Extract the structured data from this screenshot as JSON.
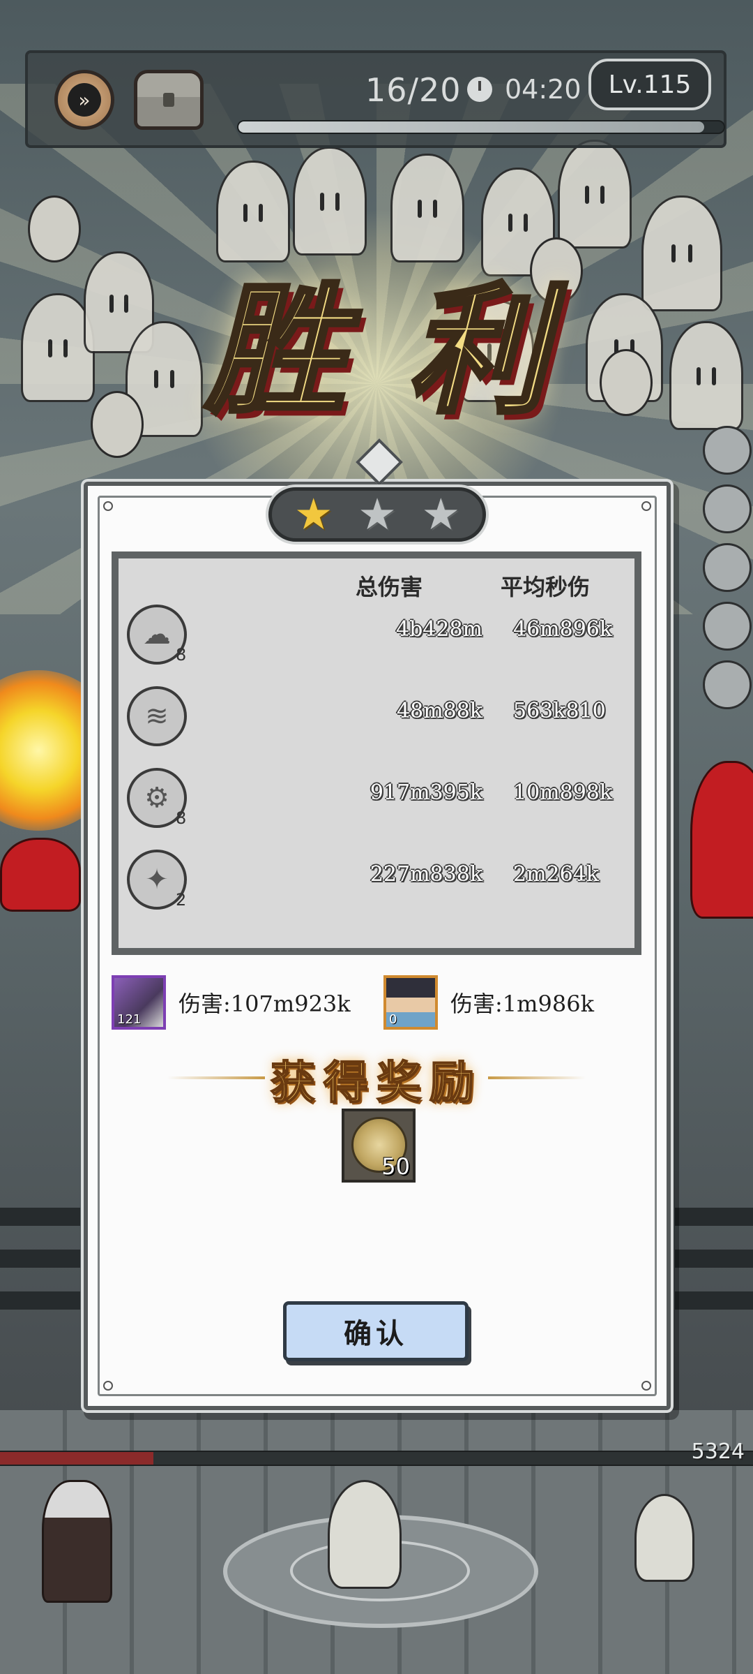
{
  "colors": {
    "panel_bg": "#fbfbfb",
    "star_on": "#f2c73e",
    "star_off": "#bfc3c4",
    "victory_gold": "#f3dc84",
    "confirm_bg": "#c6dbf5"
  },
  "hud": {
    "fast_forward_icon": "fast-forward-icon",
    "chest_icon": "treasure-chest-icon",
    "wave": "16/20",
    "clock_icon": "clock-icon",
    "timer": "04:20",
    "level": "Lv.115",
    "wave_progress": 0.96
  },
  "victory_title": "胜利",
  "result": {
    "stars_earned": 1,
    "stars_total": 3,
    "header_total": "总伤害",
    "header_avg": "平均秒伤",
    "skills": [
      {
        "icon": "ghost-skill-icon",
        "glyph": "☁",
        "count": "8",
        "total": "4b428m",
        "avg": "46m896k"
      },
      {
        "icon": "drill-skill-icon",
        "glyph": "≋",
        "count": "",
        "total": "48m88k",
        "avg": "563k810"
      },
      {
        "icon": "sawblade-skill-icon",
        "glyph": "⚙",
        "count": "8",
        "total": "917m395k",
        "avg": "10m898k"
      },
      {
        "icon": "crystal-skill-icon",
        "glyph": "✦",
        "count": "2",
        "total": "227m838k",
        "avg": "2m264k"
      }
    ],
    "heroes": [
      {
        "level": "121",
        "damage": "伤害:107m923k"
      },
      {
        "level": "0",
        "damage": "伤害:1m986k"
      }
    ]
  },
  "reward": {
    "title": "获得奖励",
    "item_icon": "hooded-coin-icon",
    "quantity": "50"
  },
  "confirm_label": "确认",
  "bottom": {
    "score": "5324"
  }
}
